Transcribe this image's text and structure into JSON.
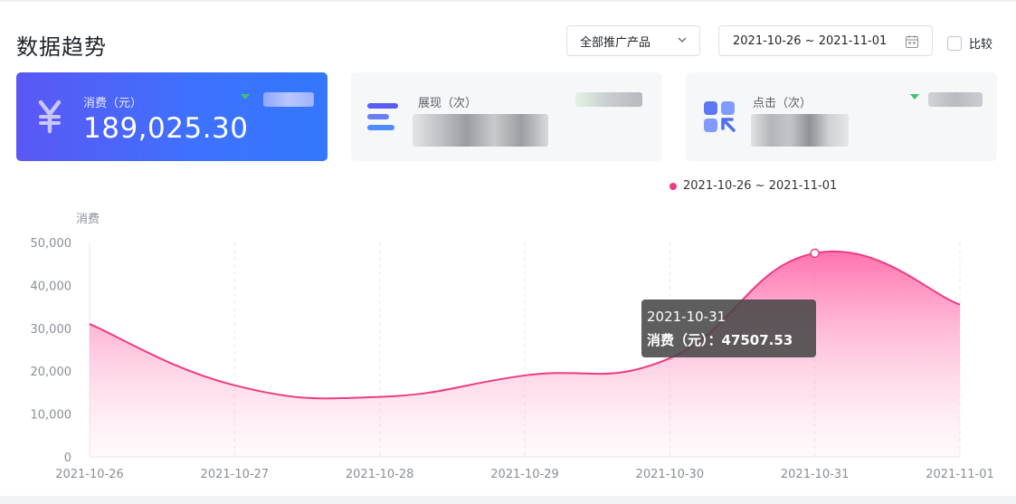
{
  "header": {
    "title": "数据趋势",
    "product_select": "全部推广产品",
    "date_range": "2021-10-26 ~ 2021-11-01",
    "compare_label": "比较"
  },
  "cards": {
    "spend": {
      "label": "消费（元）",
      "value": "189,025.30"
    },
    "impressions": {
      "label": "展现（次）"
    },
    "clicks": {
      "label": "点击（次）"
    }
  },
  "colors": {
    "accent_blue": "#3d72ff",
    "series_pink": "#ee3b83",
    "trend_green": "#3cc46b"
  },
  "icons": {
    "spend": "yuan-icon",
    "impressions": "bars-icon",
    "clicks": "click-grid-icon",
    "product_select": "chevron-down-icon",
    "date_range": "calendar-icon"
  },
  "tooltip": {
    "date": "2021-10-31",
    "text": "消费（元）：47507.53"
  },
  "chart_data": {
    "type": "area",
    "legend": "2021-10-26 ~ 2021-11-01",
    "legend_position": "top-right",
    "ylabel": "消费",
    "x": [
      "2021-10-26",
      "2021-10-27",
      "2021-10-28",
      "2021-10-29",
      "2021-10-30",
      "2021-10-31",
      "2021-11-01"
    ],
    "series": [
      {
        "name": "2021-10-26 ~ 2021-11-01",
        "values": [
          31000,
          16700,
          14000,
          19000,
          23000,
          47507.53,
          35500
        ]
      }
    ],
    "ylim": [
      0,
      50000
    ],
    "yticks": [
      "0",
      "10,000",
      "20,000",
      "30,000",
      "40,000",
      "50,000"
    ],
    "grid": "vertical-dashed"
  }
}
